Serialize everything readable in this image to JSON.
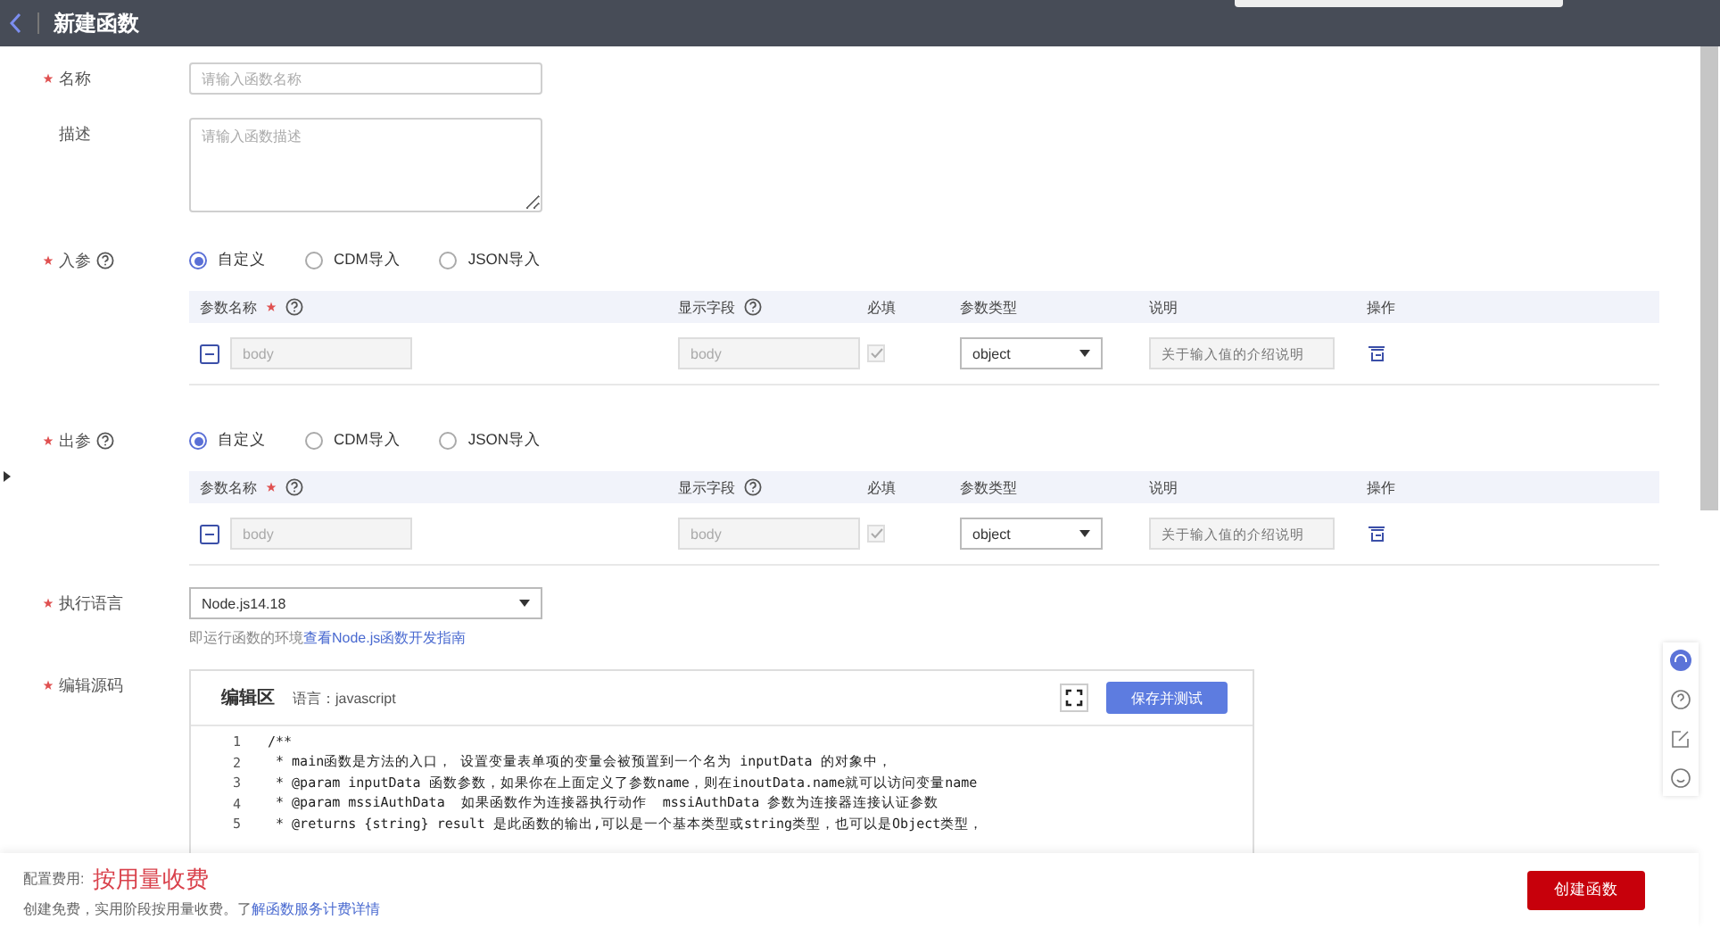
{
  "header": {
    "title": "新建函数"
  },
  "name_field": {
    "label": "名称",
    "required": true,
    "placeholder": "请输入函数名称"
  },
  "desc_field": {
    "label": "描述",
    "required": false,
    "placeholder": "请输入函数描述"
  },
  "param_sections": [
    {
      "label": "入参",
      "required": true,
      "options": [
        {
          "label": "自定义",
          "selected": true
        },
        {
          "label": "CDM导入",
          "selected": false
        },
        {
          "label": "JSON导入",
          "selected": false
        }
      ],
      "columns": [
        "参数名称",
        "显示字段",
        "必填",
        "参数类型",
        "说明",
        "操作"
      ],
      "rows": [
        {
          "name": "body",
          "display": "body",
          "required_checked": true,
          "type": "object",
          "desc_placeholder": "关于输入值的介绍说明"
        }
      ]
    },
    {
      "label": "出参",
      "required": true,
      "options": [
        {
          "label": "自定义",
          "selected": true
        },
        {
          "label": "CDM导入",
          "selected": false
        },
        {
          "label": "JSON导入",
          "selected": false
        }
      ],
      "columns": [
        "参数名称",
        "显示字段",
        "必填",
        "参数类型",
        "说明",
        "操作"
      ],
      "rows": [
        {
          "name": "body",
          "display": "body",
          "required_checked": true,
          "type": "object",
          "desc_placeholder": "关于输入值的介绍说明"
        }
      ]
    }
  ],
  "runtime": {
    "label": "执行语言",
    "required": true,
    "value": "Node.js14.18",
    "hint": "即运行函数的环境",
    "hint_link": "查看Node.js函数开发指南"
  },
  "editor": {
    "label": "编辑源码",
    "required": true,
    "title": "编辑区",
    "language": "语言：javascript",
    "save_button": "保存并测试",
    "lines": [
      {
        "number": "1",
        "code": "/**"
      },
      {
        "number": "2",
        "code": " * main函数是方法的入口， 设置变量表单项的变量会被预置到一个名为 inputData 的对象中，"
      },
      {
        "number": "3",
        "code": " * @param inputData 函数参数，如果你在上面定义了参数name，则在inoutData.name就可以访问变量name"
      },
      {
        "number": "4",
        "code": " * @param mssiAuthData  如果函数作为连接器执行动作  mssiAuthData 参数为连接器连接认证参数"
      },
      {
        "number": "5",
        "code": " * @returns {string} result 是此函数的输出,可以是一个基本类型或string类型，也可以是Object类型，"
      }
    ]
  },
  "footer": {
    "fee_label": "配置费用:",
    "fee_value": "按用量收费",
    "note": "创建免费，实用阶段按用量收费。了",
    "note_link": "解函数服务计费详情",
    "create_button": "创建函数"
  }
}
